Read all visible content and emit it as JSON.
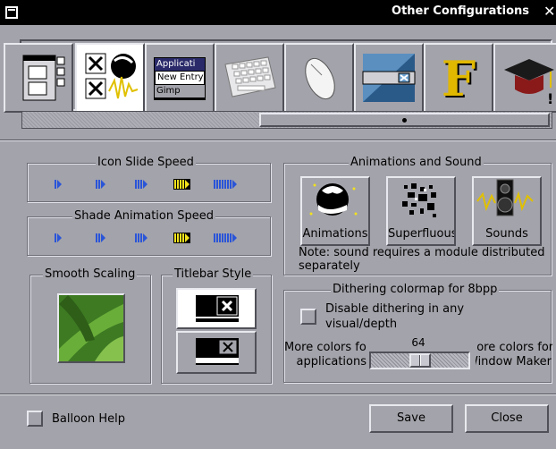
{
  "window": {
    "title": "Other Configurations"
  },
  "iconbar": {
    "items": [
      {
        "icon": "windows-thumbnail-icon",
        "label": "",
        "selected": false
      },
      {
        "icon": "effects-icon",
        "label": "",
        "selected": true
      },
      {
        "icon": "app-menu-icon",
        "label": "",
        "lines": [
          "Applicati",
          "New Entry",
          "Gimp"
        ],
        "selected": false
      },
      {
        "icon": "keyboard-icon",
        "label": "",
        "selected": false
      },
      {
        "icon": "mouse-icon",
        "label": "",
        "selected": false
      },
      {
        "icon": "titlebar-icon",
        "label": "",
        "selected": false
      },
      {
        "icon": "font-icon",
        "label": "",
        "glyph": "F",
        "selected": false
      },
      {
        "icon": "graduation-cap-icon",
        "label": "",
        "selected": false
      }
    ]
  },
  "icon_slide": {
    "label": "Icon Slide Speed",
    "selected_index": 3
  },
  "shade_anim": {
    "label": "Shade Animation Speed",
    "selected_index": 3
  },
  "smooth_scaling": {
    "label": "Smooth Scaling"
  },
  "titlebar_style": {
    "label": "Titlebar Style",
    "selected_index": 0
  },
  "animations": {
    "label": "Animations and Sound",
    "items": [
      {
        "label": "Animations"
      },
      {
        "label": "Superfluous"
      },
      {
        "label": "Sounds"
      }
    ],
    "note": "Note: sound requires a module distributed separately"
  },
  "dithering": {
    "label": "Dithering colormap for 8bpp",
    "checkbox_label": "Disable dithering in any visual/depth",
    "checked": false,
    "slider_value": "64",
    "slider_fraction": 0.5,
    "left_label_1": "More colors for",
    "left_label_2": "applications",
    "right_label_1": "More colors for",
    "right_label_2": "Window Maker"
  },
  "balloon_help": {
    "label": "Balloon Help",
    "checked": false
  },
  "buttons": {
    "save": "Save",
    "close": "Close"
  },
  "colors": {
    "bg": "#a3a3ab",
    "speed_blue": "#2a55d8",
    "speed_selected": "#f2e21c"
  }
}
